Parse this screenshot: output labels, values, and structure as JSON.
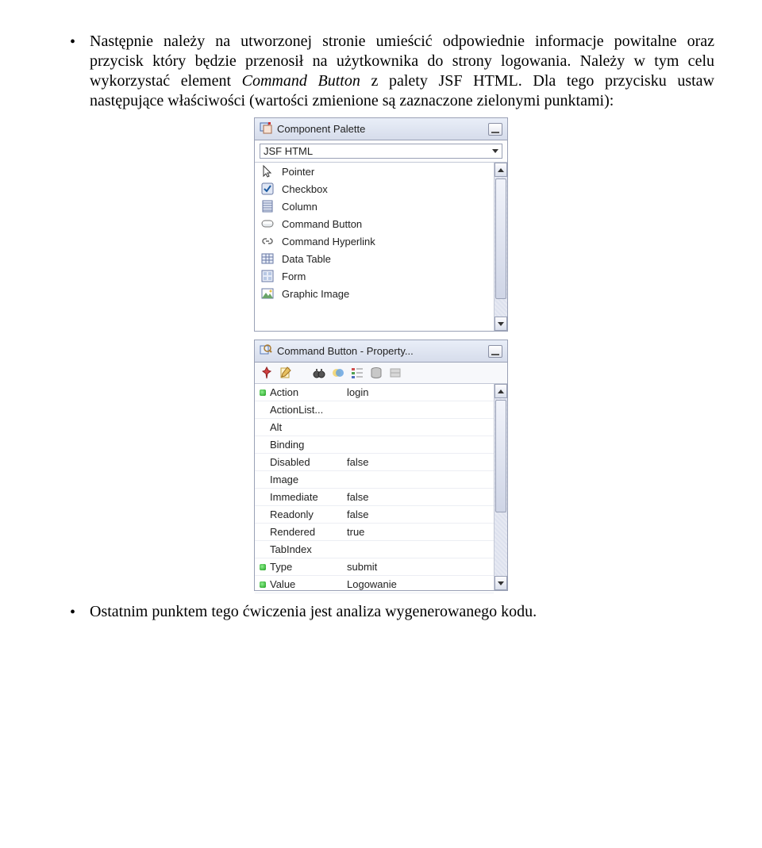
{
  "para1_a": "Następnie należy na utworzonej stronie umieścić odpowiednie informacje powitalne oraz przycisk który będzie przenosił na użytkownika do strony logowania. Należy w tym celu wykorzystać element ",
  "para1_i": "Command Button",
  "para1_b": " z palety JSF HTML. Dla tego przycisku ustaw następujące właściwości (wartości zmienione są zaznaczone zielonymi punktami):",
  "para2": "Ostatnim punktem tego ćwiczenia jest analiza wygenerowanego kodu.",
  "palette": {
    "title": "Component Palette",
    "dropdown": "JSF HTML",
    "items": [
      "Pointer",
      "Checkbox",
      "Column",
      "Command Button",
      "Command Hyperlink",
      "Data Table",
      "Form",
      "Graphic Image"
    ]
  },
  "properties": {
    "title": "Command Button - Property...",
    "rows": [
      {
        "name": "Action",
        "value": "login",
        "changed": true
      },
      {
        "name": "ActionList...",
        "value": "",
        "changed": false
      },
      {
        "name": "Alt",
        "value": "",
        "changed": false
      },
      {
        "name": "Binding",
        "value": "",
        "changed": false
      },
      {
        "name": "Disabled",
        "value": "false",
        "changed": false
      },
      {
        "name": "Image",
        "value": "",
        "changed": false
      },
      {
        "name": "Immediate",
        "value": "false",
        "changed": false
      },
      {
        "name": "Readonly",
        "value": "false",
        "changed": false
      },
      {
        "name": "Rendered",
        "value": "true",
        "changed": false
      },
      {
        "name": "TabIndex",
        "value": "",
        "changed": false
      },
      {
        "name": "Type",
        "value": "submit",
        "changed": true
      },
      {
        "name": "Value",
        "value": "Logowanie",
        "changed": true
      }
    ]
  }
}
